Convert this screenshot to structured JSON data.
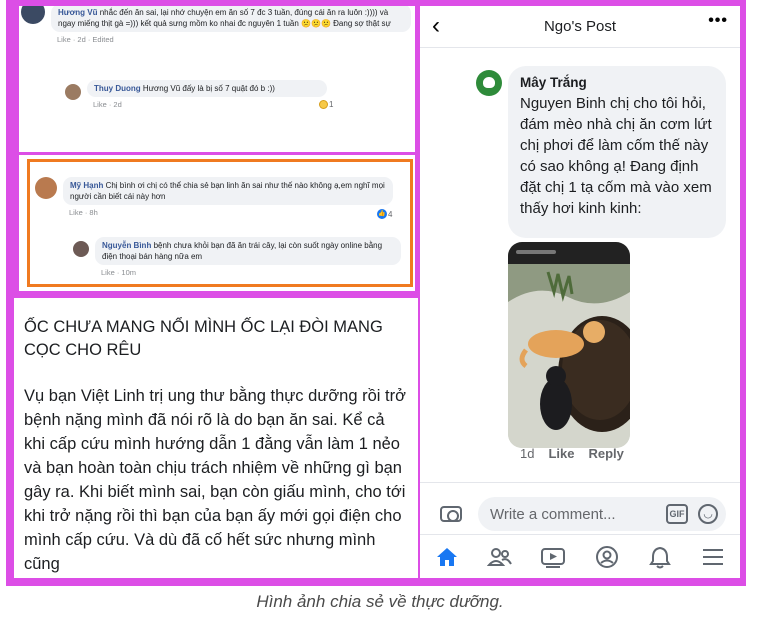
{
  "top_panel": {
    "comment1": {
      "author": "Hương Vũ",
      "text": "nhắc đến ăn sai, lại nhớ chuyện em ăn số 7 đc 3 tuần, đúng cái ăn ra luôn :)))) và ngay miếng thịt gà =))) kết quả sưng mồm ko nhai đc nguyên 1 tuần 😕😕😕 Đang sợ thật sự",
      "meta": "Like · 2d · Edited"
    },
    "comment2": {
      "author": "Thuy Duong",
      "text": "Hương Vũ đấy là bị số 7 quật đó b :))",
      "meta": "Like · 2d",
      "reactions": "1"
    }
  },
  "mid_panel": {
    "comment1": {
      "author": "Mỹ Hạnh",
      "text": "Chị bình ơi chị có thể chia sẻ bạn linh ăn sai như thế nào không ạ,em nghĩ mọi người cần biết cái này hơn",
      "meta": "Like · 8h",
      "reactions": "4"
    },
    "comment2": {
      "author": "Nguyễn Bình",
      "text": "bệnh chưa khỏi bạn đã ăn trái cây, lại còn suốt ngày online bằng điện thoại bán hàng nữa em",
      "meta": "Like · 10m"
    }
  },
  "text_panel": {
    "heading": "ỐC CHƯA MANG NỔI MÌNH ỐC LẠI ĐÒI MANG CỌC CHO RÊU",
    "paragraph": "Vụ bạn Việt Linh trị ung thư bằng thực dưỡng rồi trở bệnh nặng mình đã nói rõ là do bạn ăn sai. Kể cả khi cấp cứu mình hướng dẫn 1 đằng vẫn làm 1 nẻo và bạn hoàn toàn chịu trách nhiệm về những gì bạn gây ra. Khi biết mình sai, bạn còn giấu mình, cho tới khi trở nặng rồi thì bạn của bạn ấy mới gọi điện cho mình cấp cứu. Và dù đã cố hết sức nhưng mình cũng"
  },
  "phone": {
    "title": "Ngo's Post",
    "comment": {
      "author": "Mây Trắng",
      "text": "Nguyen Binh chị cho tôi hỏi, đám mèo nhà chị ăn cơm lứt chị phơi để làm cốm thế này có sao không ạ! Đang định đặt chị 1 tạ cốm mà vào xem thấy hơi kinh kinh:",
      "time": "1d",
      "like": "Like",
      "reply": "Reply"
    },
    "comment_placeholder": "Write a comment...",
    "gif_label": "GIF"
  },
  "caption": "Hình ảnh chia sẻ về thực dưỡng."
}
